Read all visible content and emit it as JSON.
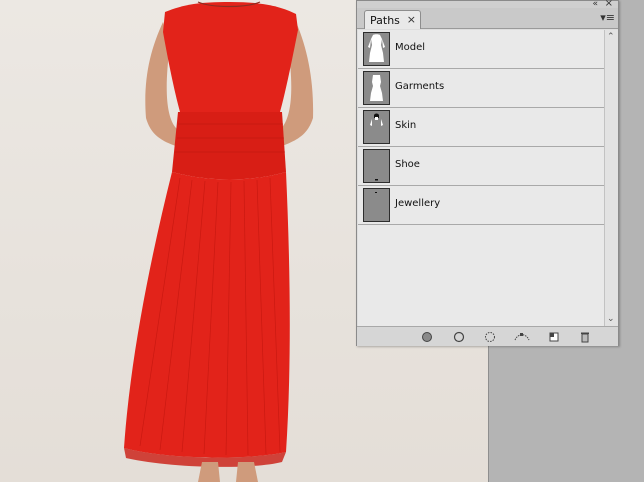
{
  "panel": {
    "tab_label": "Paths",
    "tab_close": "×",
    "close_glyph": "×",
    "collapse_glyph": "«",
    "menu_glyph": "▾≡",
    "paths": [
      {
        "label": "Model",
        "thumb": "model-silhouette"
      },
      {
        "label": "Garments",
        "thumb": "garment-silhouette"
      },
      {
        "label": "Skin",
        "thumb": "skin-silhouette"
      },
      {
        "label": "Shoe",
        "thumb": "shoe-mark"
      },
      {
        "label": "Jewellery",
        "thumb": "jewellery-mark"
      }
    ],
    "footer_icons": [
      "fill-path-icon",
      "stroke-path-icon",
      "load-path-as-selection-icon",
      "make-work-path-icon",
      "create-new-path-icon",
      "delete-path-icon"
    ]
  },
  "colors": {
    "dress": "#e2231a",
    "dress_shadow": "#b8140f",
    "skin": "#cf9b7c",
    "backdrop": "#ebe7e2"
  }
}
